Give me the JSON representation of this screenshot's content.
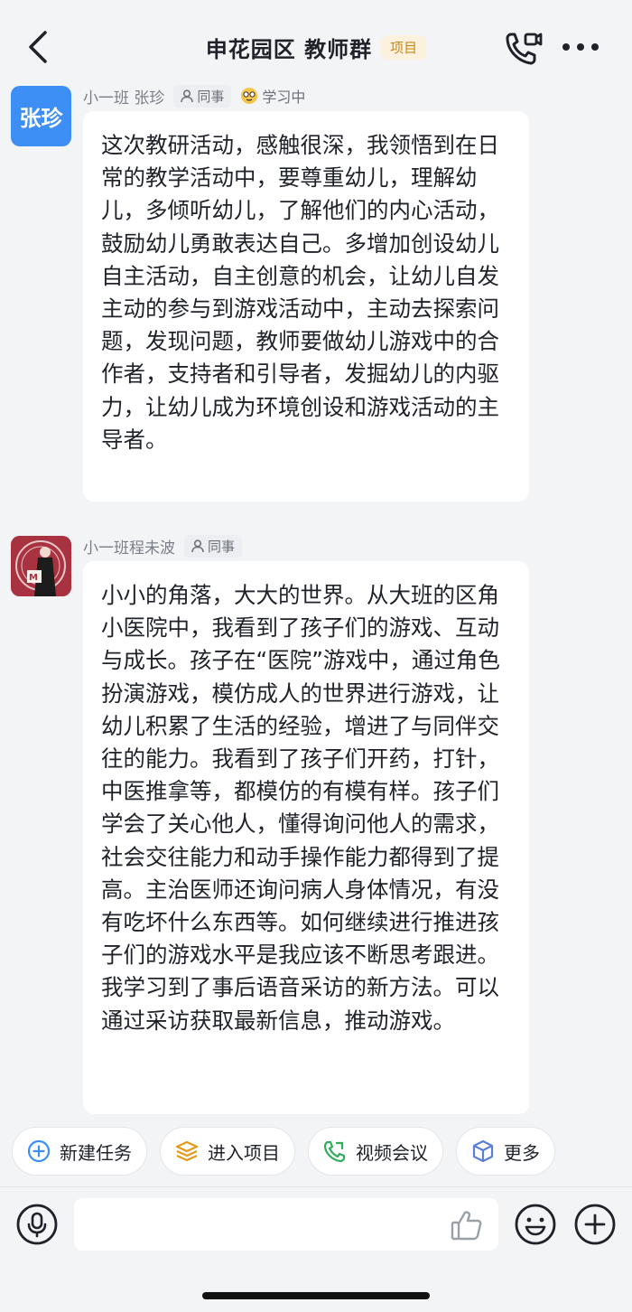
{
  "header": {
    "title": "申花园区 教师群",
    "tag": "项目"
  },
  "messages": [
    {
      "avatar_text": "张珍",
      "sender": "小一班 张珍",
      "badge": "同事",
      "status": "学习中",
      "text": "这次教研活动，感触很深，我领悟到在日常的教学活动中，要尊重幼儿，理解幼儿，多倾听幼儿，了解他们的内心活动，鼓励幼儿勇敢表达自己。多增加创设幼儿自主活动，自主创意的机会，让幼儿自发主动的参与到游戏活动中，主动去探索问题，发现问题，教师要做幼儿游戏中的合作者，支持者和引导者，发掘幼儿的内驱力，让幼儿成为环境创设和游戏活动的主导者。"
    },
    {
      "sender": "小一班程未波",
      "badge": "同事",
      "text": "小小的角落，大大的世界。从大班的区角小医院中，我看到了孩子们的游戏、互动与成长。孩子在“医院”游戏中，通过角色扮演游戏，模仿成人的世界进行游戏，让幼儿积累了生活的经验，增进了与同伴交往的能力。我看到了孩子们开药，打针，中医推拿等，都模仿的有模有样。孩子们学会了关心他人，懂得询问他人的需求，社会交往能力和动手操作能力都得到了提高。主治医师还询问病人身体情况，有没有吃坏什么东西等。如何继续进行推进孩子们的游戏水平是我应该不断思考跟进。我学习到了事后语音采访的新方法。可以通过采访获取最新信息，推动游戏。"
    }
  ],
  "quick_actions": [
    {
      "label": "新建任务",
      "icon": "plus-circle-icon"
    },
    {
      "label": "进入项目",
      "icon": "layers-icon"
    },
    {
      "label": "视频会议",
      "icon": "video-call-icon"
    },
    {
      "label": "更多",
      "icon": "cube-icon"
    }
  ],
  "input": {
    "value": "",
    "placeholder": ""
  },
  "colors": {
    "accent": "#3d8ff5",
    "tag_text": "#c98a1c",
    "tag_bg": "#fbf1dc",
    "background": "#f3f4f6"
  }
}
